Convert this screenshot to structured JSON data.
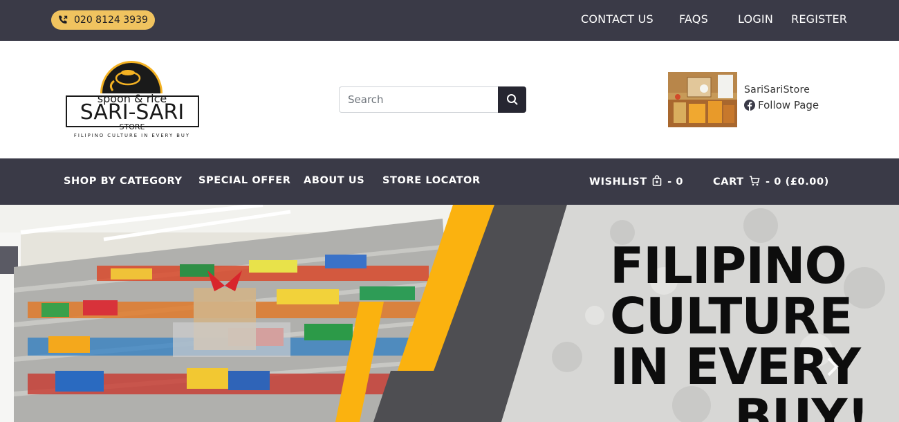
{
  "topbar": {
    "phone": "020 8124 3939",
    "links": {
      "contact": "CONTACT US",
      "faqs": "FAQS",
      "login": "LOGIN",
      "register": "REGISTER"
    }
  },
  "header": {
    "logo": {
      "line1": "spoon & rice",
      "line2": "SARI-SARI",
      "line3": "STORE",
      "tagline": "FILIPINO CULTURE IN EVERY BUY"
    },
    "search": {
      "placeholder": "Search"
    },
    "facebook": {
      "name": "SariSariStore",
      "follow": "Follow Page"
    }
  },
  "nav": {
    "items": [
      "SHOP BY CATEGORY",
      "SPECIAL OFFER",
      "ABOUT US",
      "STORE LOCATOR"
    ],
    "wishlist": {
      "label": "WISHLIST",
      "count": "- 0"
    },
    "cart": {
      "label": "CART",
      "summary": "- 0 (£0.00)"
    }
  },
  "hero": {
    "lines": [
      "FILIPINO",
      "CULTURE",
      "IN EVERY",
      "BUY!"
    ]
  },
  "colors": {
    "dark": "#3a3a47",
    "accent": "#f0c35f",
    "hero_yellow": "#fbb20f"
  },
  "icons": {
    "phone": "phone-icon",
    "search": "search-icon",
    "facebook": "facebook-icon",
    "wishlist": "bag-icon",
    "cart": "cart-icon",
    "next": "chevron-right-icon"
  }
}
